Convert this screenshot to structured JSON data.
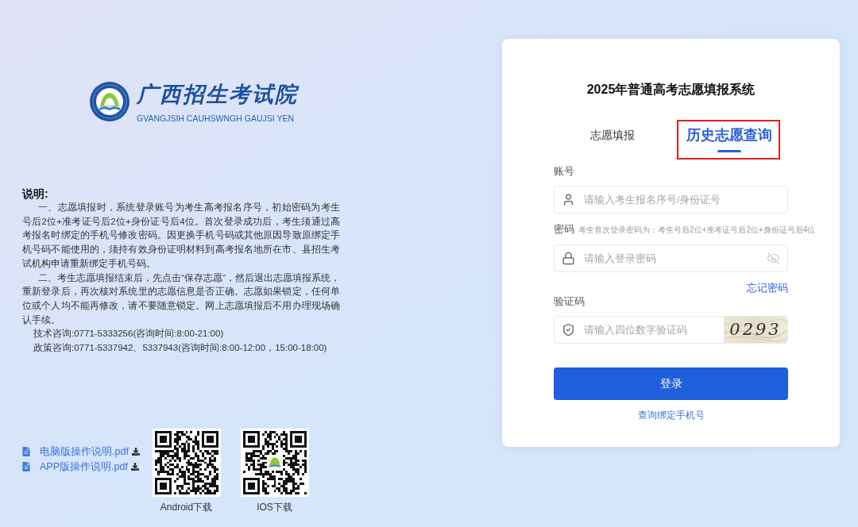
{
  "logo": {
    "title": "广西招生考试院",
    "subtitle": "GVANGJSIH CAUHSWNGH GAUJSI YEN"
  },
  "notice": {
    "title": "说明:",
    "paragraphs": [
      "一、志愿填报时，系统登录账号为考生高考报名序号，初始密码为考生号后2位+准考证号后2位+身份证号后4位。首次登录成功后，考生须通过高考报名时绑定的手机号修改密码。因更换手机号码或其他原因导致原绑定手机号码不能使用的，须持有效身份证明材料到高考报名地所在市、县招生考试机构申请重新绑定手机号码。",
      "二、考生志愿填报结束后，先点击“保存志愿”，然后退出志愿填报系统，重新登录后，再次核对系统里的志愿信息是否正确。志愿如果锁定，任何单位或个人均不能再修改，请不要随意锁定。网上志愿填报后不用办理现场确认手续。"
    ],
    "contacts": [
      "技术咨询:0771-5333256(咨询时间:8:00-21:00)",
      "政策咨询:0771-5337942、5337943(咨询时间:8:00-12:00，15:00-18:00)"
    ]
  },
  "downloads": [
    {
      "label": "电脑版操作说明.pdf"
    },
    {
      "label": "APP版操作说明.pdf"
    }
  ],
  "apps": [
    {
      "label": "Android下载",
      "center_logo": false
    },
    {
      "label": "IOS下载",
      "center_logo": true
    }
  ],
  "login": {
    "title": "2025年普通高考志愿填报系统",
    "tabs": [
      {
        "label": "志愿填报",
        "selected": false,
        "highlighted": false
      },
      {
        "label": "历史志愿查询",
        "selected": true,
        "highlighted": true
      }
    ],
    "fields": [
      {
        "kind": "account",
        "label": "账号",
        "placeholder": "请输入考生报名序号/身份证号"
      },
      {
        "kind": "password",
        "label": "密码",
        "hint": "考生首次登录密码为：考生号后2位+准考证号后2位+身份证号后4位",
        "placeholder": "请输入登录密码",
        "link": "忘记密码"
      },
      {
        "kind": "captcha",
        "label": "验证码",
        "placeholder": "请输入四位数字验证码",
        "captcha": "0293"
      }
    ],
    "submit": "登录",
    "bind_link": "查询绑定手机号"
  }
}
